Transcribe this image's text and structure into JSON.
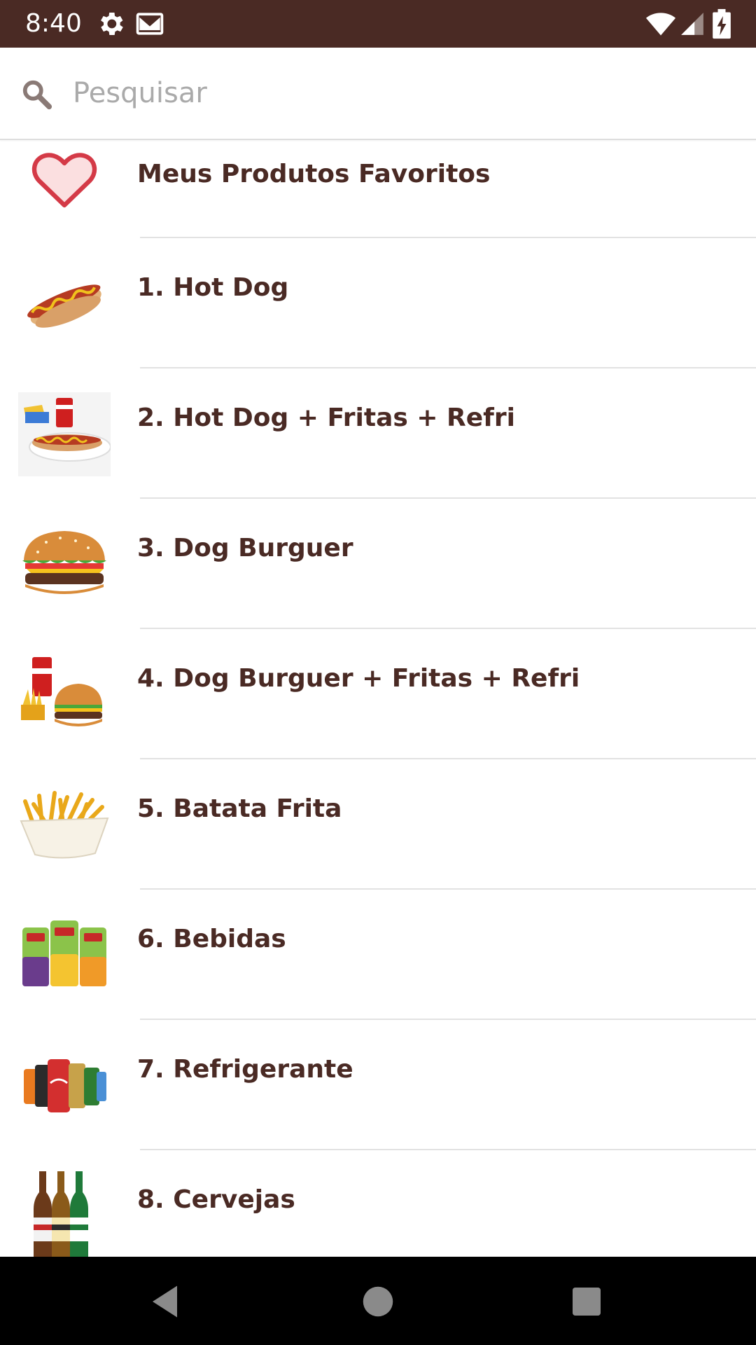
{
  "status_bar": {
    "time": "8:40",
    "background": "#4a2a24",
    "left_icons": [
      "gear-icon",
      "gmail-icon"
    ],
    "right_icons": [
      "wifi-icon",
      "signal-icon",
      "battery-charging-icon"
    ]
  },
  "search": {
    "placeholder": "Pesquisar",
    "value": "",
    "icon": "search-icon"
  },
  "list": {
    "accent_color": "#4a2a24",
    "items": [
      {
        "label": "Meus Produtos Favoritos",
        "icon": "heart-icon"
      },
      {
        "label": "1. Hot Dog",
        "icon": "hot-dog-image"
      },
      {
        "label": "2. Hot Dog + Fritas + Refri",
        "icon": "hot-dog-combo-image"
      },
      {
        "label": "3. Dog Burguer",
        "icon": "burger-image"
      },
      {
        "label": "4. Dog Burguer + Fritas + Refri",
        "icon": "burger-combo-image"
      },
      {
        "label": "5. Batata Frita",
        "icon": "fries-image"
      },
      {
        "label": "6. Bebidas",
        "icon": "juice-cans-image"
      },
      {
        "label": "7. Refrigerante",
        "icon": "soda-cans-image"
      },
      {
        "label": "8. Cervejas",
        "icon": "beer-bottles-image"
      }
    ]
  },
  "nav_bar": {
    "buttons": [
      "back-icon",
      "home-icon",
      "recents-icon"
    ]
  }
}
